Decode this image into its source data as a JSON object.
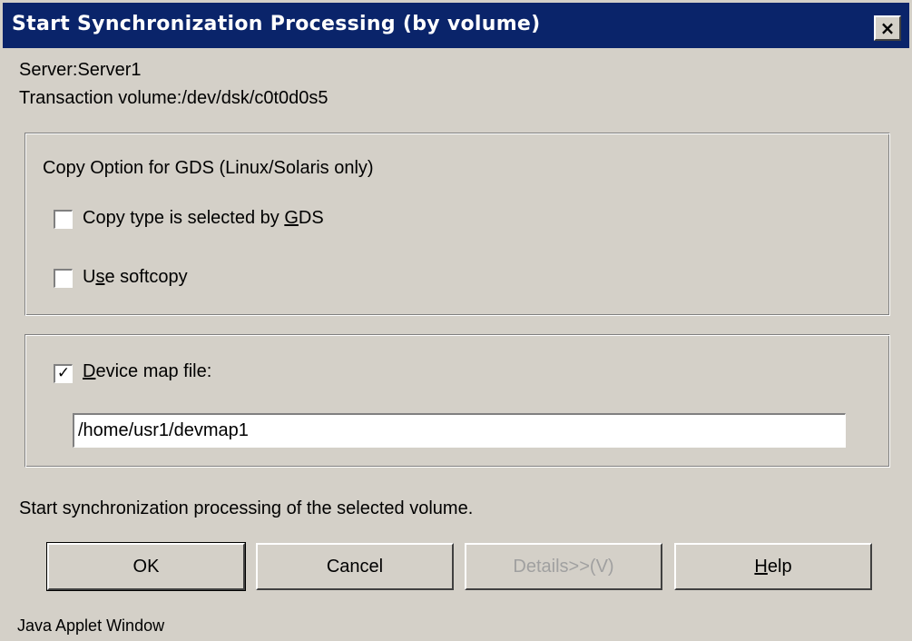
{
  "window": {
    "title": "Start Synchronization Processing (by volume)",
    "close_label": "×"
  },
  "info": {
    "server": "Server:Server1",
    "transaction_volume": "Transaction volume:/dev/dsk/c0t0d0s5"
  },
  "copy_option": {
    "heading": "Copy Option for GDS (Linux/Solaris only)",
    "gds_select": {
      "label_before": "Copy type is selected by ",
      "mnemonic": "G",
      "label_after": "DS",
      "checked": false
    },
    "softcopy": {
      "label_before": "U",
      "mnemonic": "s",
      "label_after": "e softcopy",
      "checked": false
    }
  },
  "device_map": {
    "label_before": "",
    "mnemonic": "D",
    "label_after": "evice map file:",
    "checked": true,
    "check_glyph": "✓",
    "value": "/home/usr1/devmap1"
  },
  "message": "Start synchronization processing of the selected volume.",
  "buttons": {
    "ok": "OK",
    "cancel": "Cancel",
    "details": "Details>>(V)",
    "help_before": "",
    "help_mnemonic": "H",
    "help_after": "elp"
  },
  "footer": "Java Applet Window",
  "colors": {
    "titlebar": "#0a246a",
    "face": "#d4d0c8",
    "disabled_text": "#a0a0a0"
  }
}
